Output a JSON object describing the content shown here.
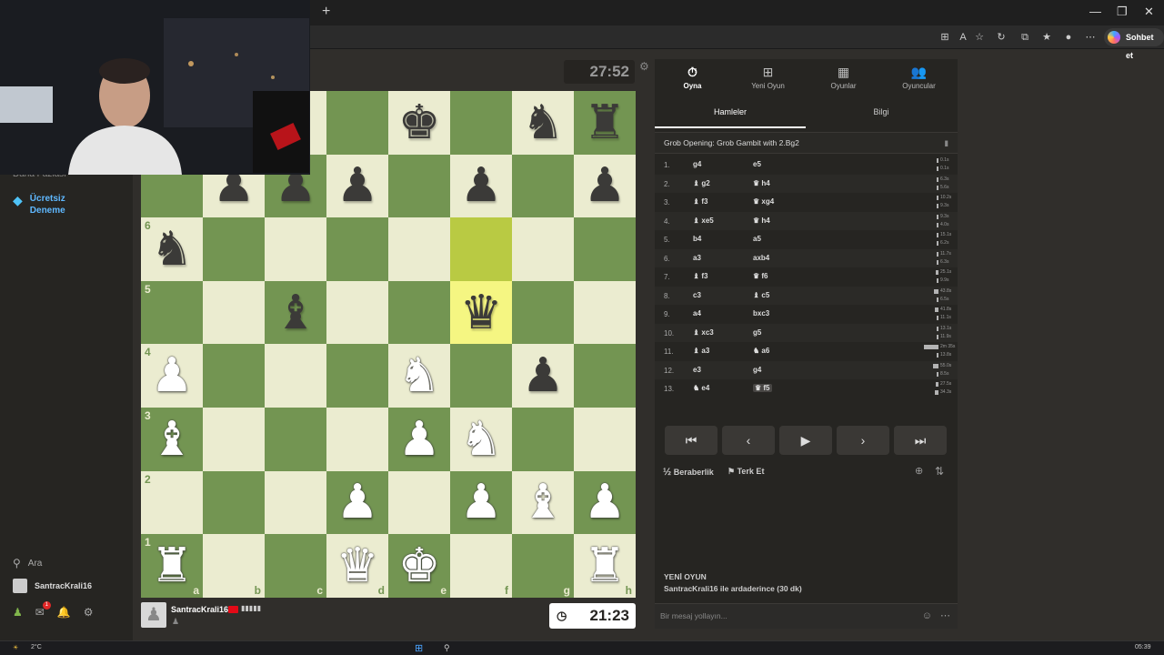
{
  "browser": {
    "new_tab_symbol": "+",
    "window_controls": [
      "—",
      "❐",
      "✕"
    ],
    "copilot_label": "Sohbet et",
    "toolbar_icons": [
      "apps-icon",
      "read-aloud-icon",
      "favorite-icon",
      "refresh-icon",
      "extensions-icon",
      "favorites-bar-icon",
      "profile-icon",
      "more-icon"
    ]
  },
  "sidebar": {
    "partial_item": "Daha Fazlası",
    "trial": "Ücretsiz Deneme",
    "search": "Ara",
    "username": "SantracKrali16",
    "mail_badge": "1"
  },
  "board": {
    "ranks": [
      "8",
      "7",
      "6",
      "5",
      "4",
      "3",
      "2",
      "1"
    ],
    "files": [
      "a",
      "b",
      "c",
      "d",
      "e",
      "f",
      "g",
      "h"
    ],
    "position": [
      [
        "",
        "",
        "",
        "",
        "k",
        "",
        "n",
        "r"
      ],
      [
        "",
        "p",
        "p",
        "p",
        "",
        "p",
        "",
        "p"
      ],
      [
        "n",
        "",
        "",
        "",
        "",
        "",
        "",
        ""
      ],
      [
        "",
        "",
        "b",
        "",
        "",
        "q",
        "",
        ""
      ],
      [
        "P",
        "",
        "",
        "",
        "N",
        "",
        "p",
        ""
      ],
      [
        "B",
        "",
        "",
        "",
        "P",
        "N",
        "",
        ""
      ],
      [
        "",
        "",
        "",
        "P",
        "",
        "P",
        "B",
        "P"
      ],
      [
        "R",
        "",
        "",
        "Q",
        "K",
        "",
        "",
        "R"
      ]
    ],
    "highlight": [
      "f6",
      "f5"
    ],
    "light_color": "#ebecd0",
    "dark_color": "#739552",
    "highlight_color": "#f5f682"
  },
  "top_player": {
    "clock": "27:52"
  },
  "bottom_player": {
    "name": "SantracKrali16",
    "flag": "TR",
    "clock": "21:23"
  },
  "panel": {
    "nav": [
      {
        "label": "Oyna",
        "icon": "⏱"
      },
      {
        "label": "Yeni Oyun",
        "icon": "⊞"
      },
      {
        "label": "Oyunlar",
        "icon": "▦"
      },
      {
        "label": "Oyuncular",
        "icon": "👥"
      }
    ],
    "tabs": [
      "Hamleler",
      "Bilgi"
    ],
    "opening": "Grob Opening: Grob Gambit with 2.Bg2",
    "moves": [
      {
        "n": "1.",
        "w": "g4",
        "b": "e5",
        "tw": "0.1s",
        "tb": "0.1s",
        "fw": 0.01,
        "fb": 0.01
      },
      {
        "n": "2.",
        "w": "♝ g2",
        "b": "♛ h4",
        "tw": "6.3s",
        "tb": "5.6s",
        "fw": 0.05,
        "fb": 0.04
      },
      {
        "n": "3.",
        "w": "♝ f3",
        "b": "♛ xg4",
        "tw": "10.2s",
        "tb": "9.3s",
        "fw": 0.08,
        "fb": 0.07
      },
      {
        "n": "4.",
        "w": "♝ xe5",
        "b": "♛ h4",
        "tw": "9.3s",
        "tb": "4.0s",
        "fw": 0.07,
        "fb": 0.03
      },
      {
        "n": "5.",
        "w": "b4",
        "b": "a5",
        "tw": "15.1s",
        "tb": "6.2s",
        "fw": 0.11,
        "fb": 0.05
      },
      {
        "n": "6.",
        "w": "a3",
        "b": "axb4",
        "tw": "11.7s",
        "tb": "6.3s",
        "fw": 0.09,
        "fb": 0.05
      },
      {
        "n": "7.",
        "w": "♝ f3",
        "b": "♛ f6",
        "tw": "25.1s",
        "tb": "9.9s",
        "fw": 0.18,
        "fb": 0.07
      },
      {
        "n": "8.",
        "w": "c3",
        "b": "♝ c5",
        "tw": "43.8s",
        "tb": "6.5s",
        "fw": 0.3,
        "fb": 0.05
      },
      {
        "n": "9.",
        "w": "a4",
        "b": "bxc3",
        "tw": "41.8s",
        "tb": "11.1s",
        "fw": 0.28,
        "fb": 0.08
      },
      {
        "n": "10.",
        "w": "♝ xc3",
        "b": "g5",
        "tw": "13.1s",
        "tb": "11.9s",
        "fw": 0.1,
        "fb": 0.09
      },
      {
        "n": "11.",
        "w": "♝ a3",
        "b": "♞ a6",
        "tw": "2m 35s",
        "tb": "13.8s",
        "fw": 1.0,
        "fb": 0.1
      },
      {
        "n": "12.",
        "w": "e3",
        "b": "g4",
        "tw": "55.0s",
        "tb": "8.5s",
        "fw": 0.37,
        "fb": 0.06
      },
      {
        "n": "13.",
        "w": "♞ e4",
        "b": "♛ f5",
        "tw": "27.5s",
        "tb": "34.3s",
        "fw": 0.2,
        "fb": 0.24
      }
    ],
    "controls": [
      "⏮",
      "‹",
      "▶",
      "›",
      "⏭"
    ],
    "draw": "Beraberlik",
    "draw_icon": "½",
    "resign": "Terk Et",
    "new_game_title": "YENİ OYUN",
    "new_game_desc": "SantracKrali16 ile ardaderince (30 dk)",
    "chat_placeholder": "Bir mesaj yollayın..."
  },
  "taskbar": {
    "temp": "2°C",
    "time": "05:39"
  }
}
